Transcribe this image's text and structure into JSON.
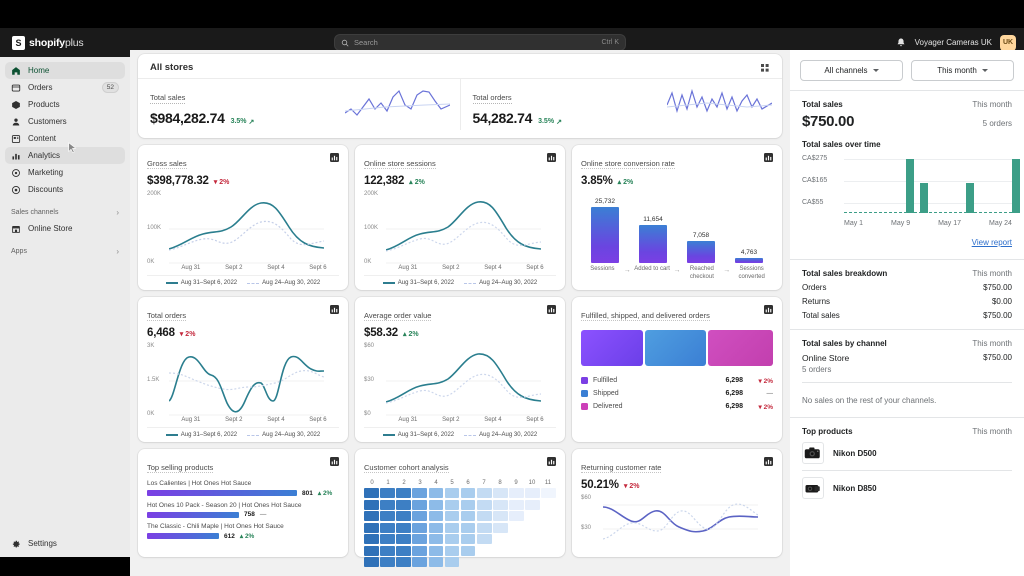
{
  "topbar": {
    "logo_mark": "S",
    "logo_text": "shopify",
    "logo_suffix": "plus",
    "search_placeholder": "Search",
    "search_shortcut": "Ctrl K",
    "bell_icon": "bell-icon",
    "store_name": "Voyager Cameras UK",
    "avatar_initials": "UK"
  },
  "sidebar": {
    "items": [
      {
        "label": "Home",
        "icon": "home-icon",
        "badge": ""
      },
      {
        "label": "Orders",
        "icon": "orders-icon",
        "badge": "52"
      },
      {
        "label": "Products",
        "icon": "products-icon",
        "badge": ""
      },
      {
        "label": "Customers",
        "icon": "customers-icon",
        "badge": ""
      },
      {
        "label": "Content",
        "icon": "content-icon",
        "badge": ""
      },
      {
        "label": "Analytics",
        "icon": "analytics-icon",
        "badge": ""
      },
      {
        "label": "Marketing",
        "icon": "marketing-icon",
        "badge": ""
      },
      {
        "label": "Discounts",
        "icon": "discounts-icon",
        "badge": ""
      }
    ],
    "sales_channels_label": "Sales channels",
    "online_store_label": "Online Store",
    "apps_label": "Apps",
    "settings_label": "Settings"
  },
  "main": {
    "all_stores": {
      "title": "All stores",
      "grid_icon": "grid-icon",
      "metrics": [
        {
          "label": "Total sales",
          "value": "$984,282.74",
          "delta": "3.5%",
          "direction": "up"
        },
        {
          "label": "Total orders",
          "value": "54,282.74",
          "delta": "3.5%",
          "direction": "up"
        }
      ]
    },
    "legend": {
      "current": "Aug 31–Sept 6, 2022",
      "previous": "Aug 24–Aug 30, 2022"
    },
    "cards": [
      {
        "title": "Gross sales",
        "value": "$398,778.32",
        "delta": "2%",
        "direction": "down",
        "y_ticks": [
          "200K",
          "100K",
          "0K"
        ],
        "x_ticks": [
          "Aug 31",
          "Sept 2",
          "Sept 4",
          "Sept 6"
        ]
      },
      {
        "title": "Online store sessions",
        "value": "122,382",
        "delta": "2%",
        "direction": "up",
        "y_ticks": [
          "200K",
          "100K",
          "0K"
        ],
        "x_ticks": [
          "Aug 31",
          "Sept 2",
          "Sept 4",
          "Sept 6"
        ]
      },
      {
        "title": "Online store conversion rate",
        "value": "3.85%",
        "delta": "2%",
        "direction": "up"
      },
      {
        "title": "Total orders",
        "value": "6,468",
        "delta": "2%",
        "direction": "down",
        "y_ticks": [
          "3K",
          "1.5K",
          "0K"
        ],
        "x_ticks": [
          "Aug 31",
          "Sept 2",
          "Sept 4",
          "Sept 6"
        ]
      },
      {
        "title": "Average order value",
        "value": "$58.32",
        "delta": "2%",
        "direction": "up",
        "y_ticks": [
          "$60",
          "$30",
          "$0"
        ],
        "x_ticks": [
          "Aug 31",
          "Sept 2",
          "Sept 4",
          "Sept 6"
        ]
      },
      {
        "title": "Fulfilled, shipped, and delivered orders"
      },
      {
        "title": "Top selling products"
      },
      {
        "title": "Customer cohort analysis"
      },
      {
        "title": "Returning customer rate",
        "value": "50.21%",
        "delta": "2%",
        "direction": "down",
        "y_ticks": [
          "$60",
          "$30"
        ]
      }
    ],
    "funnel": {
      "steps": [
        {
          "label": "Sessions",
          "value": "25,732"
        },
        {
          "label": "Added to cart",
          "value": "11,654"
        },
        {
          "label": "Reached checkout",
          "value": "7,058"
        },
        {
          "label": "Sessions converted",
          "value": "4,763"
        }
      ],
      "arrow": "→"
    },
    "fulfillment": {
      "rows": [
        {
          "name": "Fulfilled",
          "value": "6,298",
          "delta": "2%",
          "direction": "down",
          "color": "#7b3fe4"
        },
        {
          "name": "Shipped",
          "value": "6,298",
          "delta": "—",
          "direction": "flat",
          "color": "#3b7fd4"
        },
        {
          "name": "Delivered",
          "value": "6,298",
          "delta": "2%",
          "direction": "down",
          "color": "#cc3fb8"
        }
      ]
    },
    "top_products": {
      "rows": [
        {
          "name": "Los Calientes | Hot Ones Hot Sauce",
          "value": "801",
          "delta": "2%",
          "direction": "up"
        },
        {
          "name": "Hot Ones 10 Pack - Season 20 | Hot Ones Hot Sauce",
          "value": "758",
          "delta": "—",
          "direction": "flat"
        },
        {
          "name": "The Classic - Chili Maple | Hot Ones Hot Sauce",
          "value": "612",
          "direction": "up",
          "delta": "2%"
        }
      ]
    },
    "cohort": {
      "columns": [
        "0",
        "1",
        "2",
        "3",
        "4",
        "5",
        "6",
        "7",
        "8",
        "9",
        "10",
        "11"
      ]
    }
  },
  "right_panel": {
    "channel_filter": "All channels",
    "date_filter": "This month",
    "total_sales": {
      "label": "Total sales",
      "period": "This month",
      "value": "$750.00",
      "orders": "5 orders"
    },
    "over_time": {
      "title": "Total sales over time",
      "view_report": "View report"
    },
    "breakdown": {
      "title": "Total sales breakdown",
      "period": "This month",
      "rows": [
        {
          "label": "Orders",
          "value": "$750.00"
        },
        {
          "label": "Returns",
          "value": "$0.00"
        },
        {
          "label": "Total sales",
          "value": "$750.00"
        }
      ]
    },
    "by_channel": {
      "title": "Total sales by channel",
      "period": "This month",
      "channel": "Online Store",
      "channel_value": "$750.00",
      "channel_orders": "5 orders",
      "note": "No sales on the rest of your channels."
    },
    "top_products": {
      "title": "Top products",
      "period": "This month",
      "items": [
        {
          "name": "Nikon D500",
          "icon": "camera-icon"
        },
        {
          "name": "Nikon D850",
          "icon": "camera-icon"
        }
      ]
    }
  },
  "chart_data": [
    {
      "type": "line",
      "title": "Total sales",
      "series": [
        {
          "name": "Total sales",
          "values": [
            42,
            38,
            46,
            40,
            52,
            44,
            58,
            50,
            46,
            60,
            48,
            55,
            50,
            44,
            58,
            52,
            46,
            50
          ]
        }
      ],
      "ylim": [
        30,
        65
      ],
      "grid": false,
      "legend": "none"
    },
    {
      "type": "line",
      "title": "Total orders",
      "series": [
        {
          "name": "Total orders",
          "values": [
            50,
            40,
            58,
            44,
            55,
            38,
            60,
            42,
            56,
            46,
            52,
            40,
            58,
            44,
            50,
            42,
            55,
            48
          ]
        }
      ],
      "ylim": [
        30,
        65
      ],
      "grid": false,
      "legend": "none"
    },
    {
      "type": "line",
      "title": "Gross sales",
      "xlabel": "",
      "ylabel": "",
      "x": [
        "Aug 31",
        "Sept 2",
        "Sept 4",
        "Sept 6"
      ],
      "ylim": [
        0,
        200000
      ],
      "yticks": [
        0,
        100000,
        200000
      ],
      "series": [
        {
          "name": "Aug 31–Sept 6, 2022",
          "values": [
            62000,
            78000,
            96000,
            103000,
            100000,
            112000,
            150000,
            178000,
            170000,
            148000,
            96000,
            76000,
            70000,
            66000
          ]
        },
        {
          "name": "Aug 24–Aug 30, 2022",
          "values": [
            60000,
            72000,
            84000,
            88000,
            80000,
            92000,
            118000,
            128000,
            126000,
            112000,
            80000,
            72000,
            76000,
            80000
          ]
        }
      ],
      "legend": "bottom"
    },
    {
      "type": "line",
      "title": "Online store sessions",
      "x": [
        "Aug 31",
        "Sept 2",
        "Sept 4",
        "Sept 6"
      ],
      "ylim": [
        0,
        200000
      ],
      "yticks": [
        0,
        100000,
        200000
      ],
      "series": [
        {
          "name": "Aug 31–Sept 6, 2022",
          "values": [
            60000,
            76000,
            96000,
            102000,
            100000,
            110000,
            152000,
            176000,
            168000,
            146000,
            92000,
            74000,
            72000,
            64000
          ]
        },
        {
          "name": "Aug 24–Aug 30, 2022",
          "values": [
            58000,
            70000,
            82000,
            86000,
            78000,
            94000,
            120000,
            130000,
            128000,
            110000,
            78000,
            74000,
            80000,
            82000
          ]
        }
      ],
      "legend": "bottom"
    },
    {
      "type": "bar",
      "title": "Online store conversion rate",
      "categories": [
        "Sessions",
        "Added to cart",
        "Reached checkout",
        "Sessions converted"
      ],
      "values": [
        25732,
        11654,
        7058,
        4763
      ],
      "ylim": [
        0,
        25732
      ],
      "legend": "none"
    },
    {
      "type": "line",
      "title": "Total orders",
      "x": [
        "Aug 31",
        "Sept 2",
        "Sept 4",
        "Sept 6"
      ],
      "ylim": [
        0,
        3000
      ],
      "yticks": [
        0,
        1500,
        3000
      ],
      "series": [
        {
          "name": "Aug 31–Sept 6, 2022",
          "values": [
            1200,
            2100,
            2800,
            2700,
            1900,
            1950,
            1150,
            700,
            1250,
            1800,
            1300,
            1250,
            2600,
            2850,
            2500,
            2400,
            2350
          ]
        },
        {
          "name": "Aug 24–Aug 30, 2022",
          "values": [
            2050,
            2000,
            1900,
            1800,
            1600,
            1450,
            1400,
            1500,
            1450,
            1500,
            1550,
            1600,
            1800,
            2000,
            2050,
            1900,
            1850
          ]
        }
      ],
      "legend": "bottom"
    },
    {
      "type": "line",
      "title": "Average order value",
      "x": [
        "Aug 31",
        "Sept 2",
        "Sept 4",
        "Sept 6"
      ],
      "ylim": [
        0,
        60
      ],
      "yticks": [
        0,
        30,
        60
      ],
      "series": [
        {
          "name": "Aug 31–Sept 6, 2022",
          "values": [
            19,
            24,
            30,
            32,
            31,
            35,
            48,
            56,
            54,
            46,
            29,
            23,
            22,
            20
          ]
        },
        {
          "name": "Aug 24–Aug 30, 2022",
          "values": [
            18,
            22,
            26,
            27,
            24,
            29,
            37,
            40,
            40,
            35,
            25,
            23,
            25,
            26
          ]
        }
      ],
      "legend": "bottom"
    },
    {
      "type": "bar",
      "title": "Fulfilled, shipped, and delivered orders",
      "categories": [
        "Fulfilled",
        "Shipped",
        "Delivered"
      ],
      "values": [
        6298,
        6298,
        6298
      ],
      "legend": "bottom"
    },
    {
      "type": "bar",
      "title": "Top selling products",
      "categories": [
        "Los Calientes | Hot Ones Hot Sauce",
        "Hot Ones 10 Pack - Season 20 | Hot Ones Hot Sauce",
        "The Classic - Chili Maple | Hot Ones Hot Sauce"
      ],
      "values": [
        801,
        758,
        612
      ],
      "legend": "none"
    },
    {
      "type": "heatmap",
      "title": "Customer cohort analysis",
      "columns": [
        "0",
        "1",
        "2",
        "3",
        "4",
        "5",
        "6",
        "7",
        "8",
        "9",
        "10",
        "11"
      ],
      "rows": 7,
      "legend": "none"
    },
    {
      "type": "line",
      "title": "Returning customer rate",
      "ylim": [
        30,
        60
      ],
      "yticks": [
        30,
        60
      ],
      "series": [
        {
          "name": "Aug 31–Sept 6, 2022",
          "values": [
            50,
            47,
            42,
            40,
            45,
            50,
            46,
            40,
            38,
            36,
            41,
            46,
            45,
            44
          ]
        },
        {
          "name": "Aug 24–Aug 30, 2022",
          "values": [
            30,
            33,
            40,
            48,
            52,
            46,
            38,
            36,
            42,
            50,
            56,
            52,
            46,
            44
          ]
        }
      ],
      "legend": "none"
    },
    {
      "type": "bar",
      "title": "Total sales over time",
      "categories": [
        "May 1",
        "May 9",
        "May 17",
        "May 24"
      ],
      "x": [
        "May 1",
        "May 9",
        "May 17",
        "May 24"
      ],
      "values": [
        0,
        0,
        0,
        0,
        0,
        0,
        0,
        0,
        0,
        0,
        275,
        150,
        0,
        0,
        0,
        0,
        150,
        0,
        0,
        0,
        0,
        0,
        275,
        0
      ],
      "ylim": [
        0,
        275
      ],
      "yticks": [
        "CA$55",
        "CA$165",
        "CA$275"
      ],
      "ylabel": "",
      "grid": true,
      "legend": "none"
    }
  ]
}
